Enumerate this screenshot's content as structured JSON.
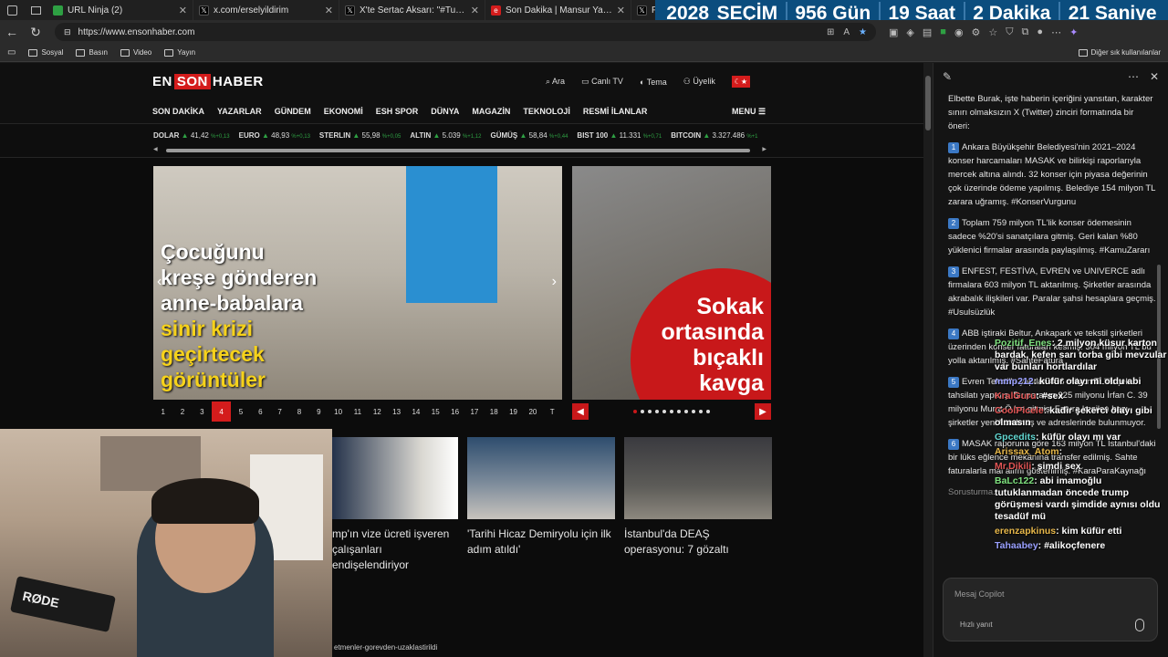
{
  "tabs": [
    {
      "label": "URL Ninja (2)",
      "color": "#2ea043"
    },
    {
      "label": "x.com/erselyildirim",
      "color": "#000000"
    },
    {
      "label": "X'te Sertac Aksarı: \"#Turkiye #Hul",
      "color": "#000000"
    },
    {
      "label": "Son Dakika | Mansur Yavaş'tan An",
      "color": "#d41c1c"
    },
    {
      "label": "P",
      "color": "#000000"
    }
  ],
  "countdown": {
    "year": "2028",
    "word": "SEÇİM",
    "days": "956 Gün",
    "hours": "19 Saat",
    "minutes": "2 Dakika",
    "seconds": "21 Saniye"
  },
  "address": {
    "url": "https://www.ensonhaber.com"
  },
  "bookmarks": {
    "items": [
      "Sosyal",
      "Basın",
      "Video",
      "Yayın"
    ],
    "other": "Diğer sık kullanılanlar"
  },
  "site": {
    "logo": {
      "en": "EN",
      "son": "SON",
      "haber": "HABER"
    },
    "head_links": [
      "Ara",
      "Canlı TV",
      "Tema",
      "Üyelik"
    ],
    "nav": [
      "SON DAKİKA",
      "YAZARLAR",
      "GÜNDEM",
      "EKONOMİ",
      "ESH SPOR",
      "DÜNYA",
      "MAGAZİN",
      "TEKNOLOJİ",
      "RESMİ İLANLAR"
    ],
    "menu": "MENU"
  },
  "ticker": [
    {
      "name": "DOLAR",
      "value": "41,42",
      "change": "%+0,13"
    },
    {
      "name": "EURO",
      "value": "48,93",
      "change": "%+0,13"
    },
    {
      "name": "STERLIN",
      "value": "55,98",
      "change": "%+0,05"
    },
    {
      "name": "ALTIN",
      "value": "5.039",
      "change": "%+1,12"
    },
    {
      "name": "GÜMÜŞ",
      "value": "58,84",
      "change": "%+0,44"
    },
    {
      "name": "BIST 100",
      "value": "11.331",
      "change": "%+0,71"
    },
    {
      "name": "BITCOIN",
      "value": "3.327.486",
      "change": "%+1"
    }
  ],
  "hero": {
    "lines": [
      {
        "text": "Çocuğunu",
        "style": "w"
      },
      {
        "text": "kreşe gönderen",
        "style": "w"
      },
      {
        "text": "anne-babalara",
        "style": "w"
      },
      {
        "text": "sinir krizi",
        "style": "y"
      },
      {
        "text": "geçirtecek",
        "style": "y"
      },
      {
        "text": "görüntüler",
        "style": "y"
      }
    ],
    "pages": [
      "1",
      "2",
      "3",
      "4",
      "5",
      "6",
      "7",
      "8",
      "9",
      "10",
      "11",
      "12",
      "13",
      "14",
      "15",
      "16",
      "17",
      "18",
      "19",
      "20",
      "T"
    ],
    "active_page": "4"
  },
  "side_hero": {
    "lines": [
      "Sokak",
      "ortasında",
      "bıçaklı",
      "kavga"
    ]
  },
  "cards": [
    {
      "caption": "mp'ın vize ücreti işveren çalışanları endişelendiriyor"
    },
    {
      "caption": "'Tarihi Hicaz Demiryolu için ilk adım atıldı'"
    },
    {
      "caption": "İstanbul'da DEAŞ operasyonu: 7 gözaltı"
    }
  ],
  "statusbar": "etmenler-gorevden-uzaklastirildi",
  "webcam": {
    "mic_brand": "RØDE"
  },
  "panel": {
    "intro": "Elbette Burak, işte haberin içeriğini yansıtan, karakter sınırı olmaksızın X (Twitter) zinciri formatında bir öneri:",
    "points": [
      {
        "n": "1",
        "text": "Ankara Büyükşehir Belediyesi'nin 2021–2024 konser harcamaları MASAK ve bilirkişi raporlarıyla mercek altına alındı. 32 konser için piyasa değerinin çok üzerinde ödeme yapılmış. Belediye 154 milyon TL zarara uğramış. #KonserVurgunu"
      },
      {
        "n": "2",
        "text": "Toplam 759 milyon TL'lik konser ödemesinin sadece %20'si sanatçılara gitmiş. Geri kalan %80 yüklenici firmalar arasında paylaşılmış. #KamuZararı"
      },
      {
        "n": "3",
        "text": "ENFEST, FESTİVA, EVREN ve UNIVERCE adlı firmalara 603 milyon TL aktarılmış. Şirketler arasında akrabalık ilişkileri var. Paralar şahsi hesaplara geçmiş. #Usulsüzlük"
      },
      {
        "n": "4",
        "text": "ABB iştiraki Beltur, Ankapark ve tekstil şirketleri üzerinden konser faturaları kesmiş. 304 milyon TL bu yolla aktarılmış. #SahteFatura"
      },
      {
        "n": "5",
        "text": "Evren Tekstil'e yapılan 456 milyon TL'lik çek tahsilatı yapmış. Bu paranın 325 milyonu İrfan C. 39 milyonu Murat Ö.'ye gitmiş. Fatura kesilen bazı şirketler yeni kurulmuş ve adreslerinde bulunmuyor."
      },
      {
        "n": "6",
        "text": "MASAK raporuna göre 163 milyon TL İstanbul'daki bir lüks eğlence mekânına transfer edilmiş. Sahte faturalarla mal alımı gösterilmiş. #KaraParaKaynağı"
      }
    ],
    "more": "Sorusturma...",
    "input_placeholder": "Mesaj Copilot",
    "quick": "Hızlı yanıt"
  },
  "chat": [
    {
      "user": "Pozitif_Enes",
      "text": "2 milyon küsur karton bardak, kefen sarı torba gibi mevzular var bunları hortlardılar",
      "cls": "u1"
    },
    {
      "user": "mmp212",
      "text": "küfür olayı mi oldu abi",
      "cls": "u3"
    },
    {
      "user": "KralGuru",
      "text": "#sex",
      "cls": "u2"
    },
    {
      "user": "CoolPicele",
      "text": "kadir şekerci olayı gibi olmasın",
      "cls": "u2"
    },
    {
      "user": "Gpcedits",
      "text": "küfür olayı mı var",
      "cls": "u5"
    },
    {
      "user": "Arissax_Atom",
      "text": "",
      "cls": "u4"
    },
    {
      "user": "Mr.Dikili",
      "text": "şimdi sex",
      "cls": "u2"
    },
    {
      "user": "BaLc122",
      "text": "abi imamoğlu tutuklanmadan öncede trump görüşmesi vardı şimdide aynısı oldu tesadüf mü",
      "cls": "u1"
    },
    {
      "user": "erenzapkinus",
      "text": "kim küfür etti",
      "cls": "u4"
    },
    {
      "user": "Tahaabey",
      "text": "#alikoçfenere",
      "cls": "u3"
    }
  ]
}
